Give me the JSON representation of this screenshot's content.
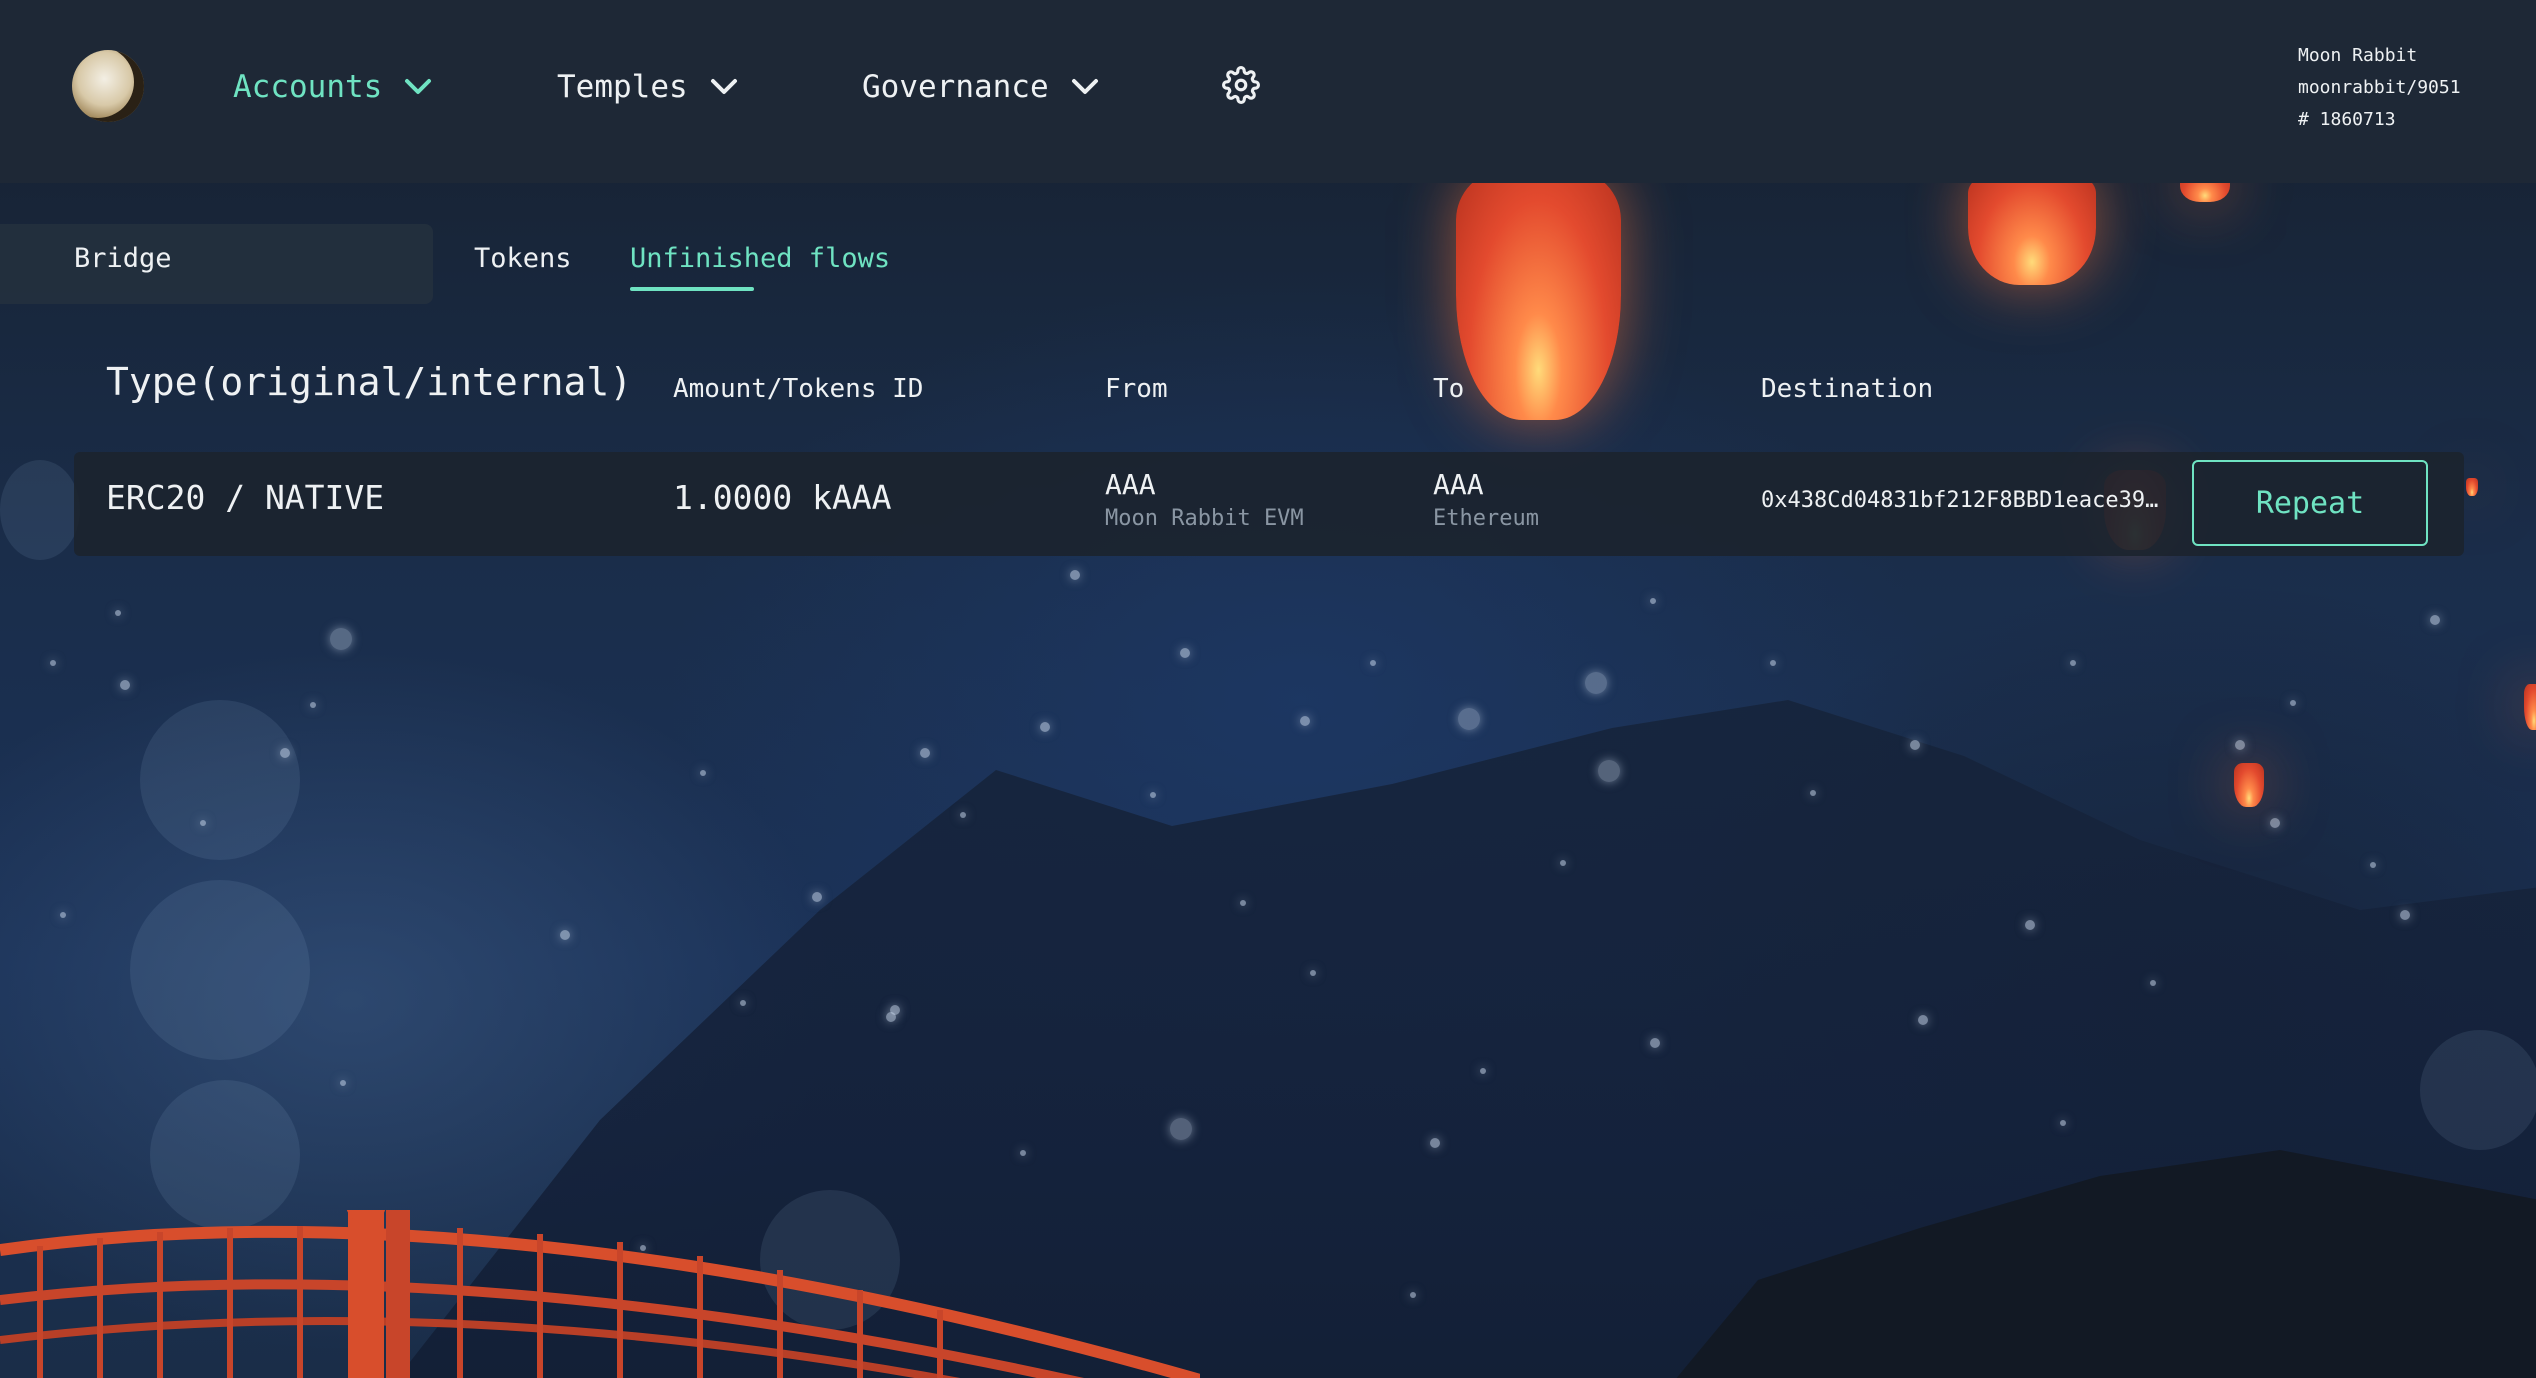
{
  "header": {
    "nav": [
      {
        "label": "Accounts",
        "active": true
      },
      {
        "label": "Temples",
        "active": false
      },
      {
        "label": "Governance",
        "active": false
      }
    ],
    "account": {
      "name": "Moon Rabbit",
      "path": "moonrabbit/9051",
      "block": "# 1860713"
    },
    "icons": {
      "logo": "moon-rabbit-logo",
      "settings": "gear-icon",
      "dropdown": "chevron-down-icon"
    }
  },
  "tabs": [
    {
      "label": "Bridge",
      "active": false
    },
    {
      "label": "Tokens",
      "active": false
    },
    {
      "label": "Unfinished flows",
      "active": true
    }
  ],
  "table": {
    "columns": [
      "Type(original/internal)",
      "Amount/Tokens ID",
      "From",
      "To",
      "Destination"
    ],
    "rows": [
      {
        "type": "ERC20 / NATIVE",
        "amount": "1.0000 kAAA",
        "from_symbol": "AAA",
        "from_network": "Moon Rabbit EVM",
        "to_symbol": "AAA",
        "to_network": "Ethereum",
        "destination": "0x438Cd04831bf212F8BBD1eace39…",
        "action": "Repeat"
      }
    ]
  },
  "colors": {
    "accent": "#6fe3c2",
    "header_bg": "#1e2836",
    "row_bg": "#1c242e"
  }
}
